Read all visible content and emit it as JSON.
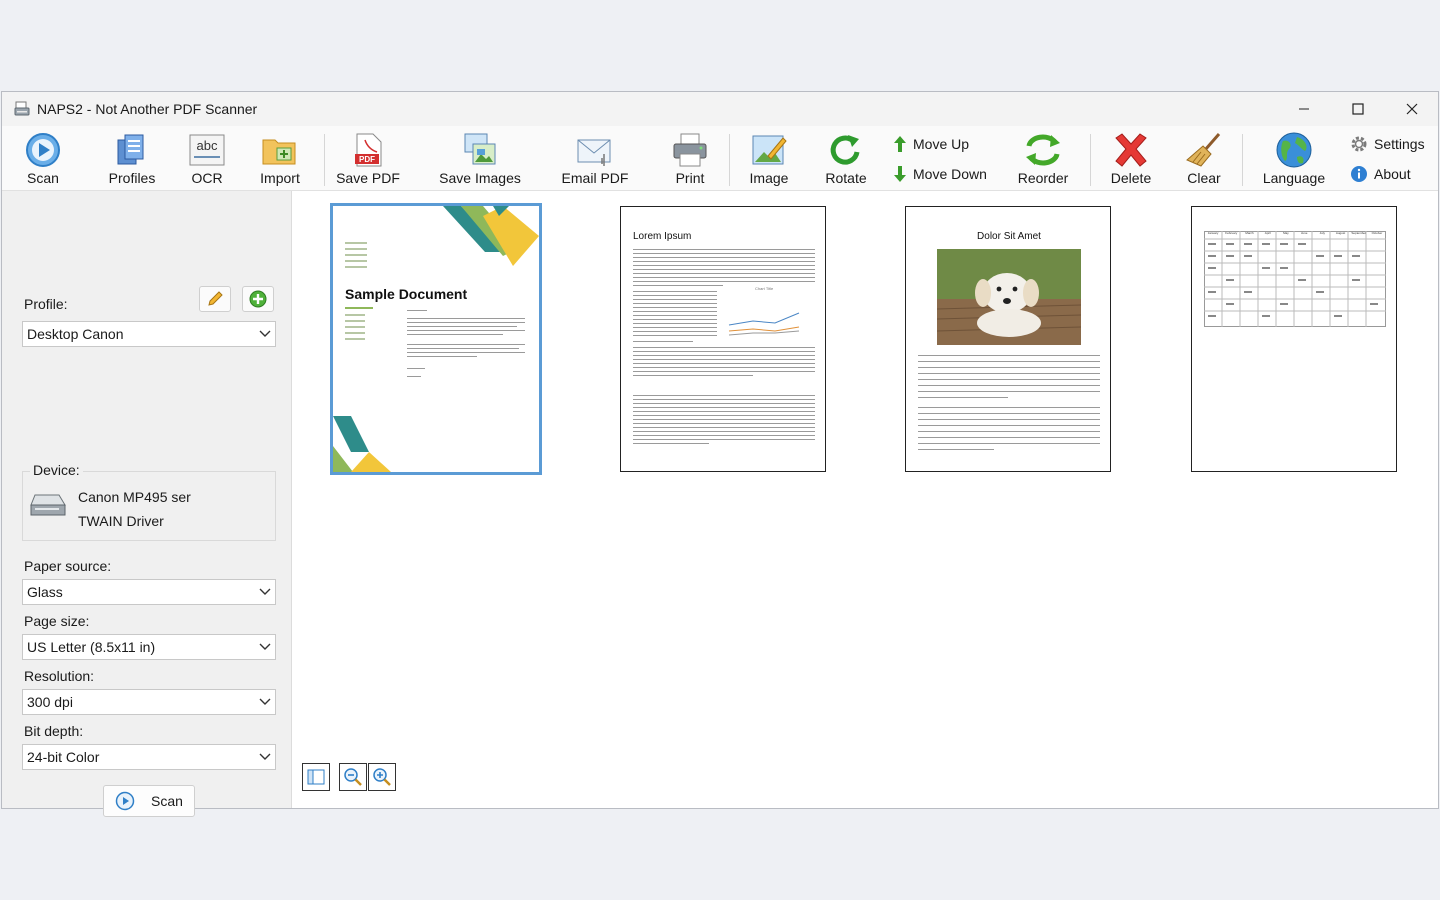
{
  "window": {
    "title": "NAPS2 - Not Another PDF Scanner"
  },
  "toolbar": {
    "scan": "Scan",
    "profiles": "Profiles",
    "ocr": "OCR",
    "import": "Import",
    "save_pdf": "Save PDF",
    "save_images": "Save Images",
    "email_pdf": "Email PDF",
    "print": "Print",
    "image": "Image",
    "rotate": "Rotate",
    "move_up": "Move Up",
    "move_down": "Move Down",
    "reorder": "Reorder",
    "delete": "Delete",
    "clear": "Clear",
    "language": "Language",
    "settings": "Settings",
    "about": "About"
  },
  "sidebar": {
    "profile_label": "Profile:",
    "profile_value": "Desktop Canon",
    "device_label": "Device:",
    "device_name": "Canon MP495 ser",
    "device_driver": "TWAIN Driver",
    "paper_source_label": "Paper source:",
    "paper_source_value": "Glass",
    "page_size_label": "Page size:",
    "page_size_value": "US Letter (8.5x11 in)",
    "resolution_label": "Resolution:",
    "resolution_value": "300 dpi",
    "bit_depth_label": "Bit depth:",
    "bit_depth_value": "24-bit Color",
    "scan_button": "Scan"
  },
  "pages": [
    {
      "heading": "Sample Document",
      "selected": true
    },
    {
      "heading": "Lorem Ipsum",
      "chart_title": "Chart Title"
    },
    {
      "heading": "Dolor Sit Amet"
    },
    {
      "heading": "",
      "table_headers": [
        "January",
        "February",
        "March",
        "April",
        "May",
        "June",
        "July",
        "August",
        "September",
        "October"
      ]
    }
  ],
  "colors": {
    "selection": "#5b9bd5",
    "accent_blue": "#1e78d7"
  }
}
